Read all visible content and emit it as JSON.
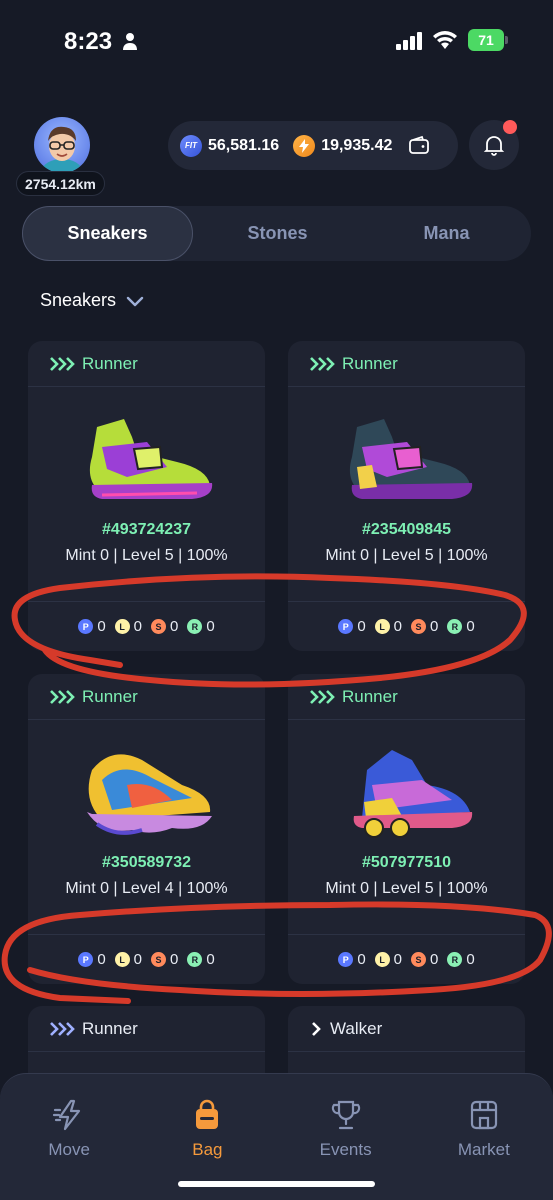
{
  "status_bar": {
    "time": "8:23",
    "battery": "71"
  },
  "header": {
    "distance": "2754.12km",
    "fit_balance": "56,581.16",
    "energy_balance": "19,935.42",
    "fit_coin_label": "FIT"
  },
  "tabs": [
    {
      "label": "Sneakers",
      "active": true
    },
    {
      "label": "Stones",
      "active": false
    },
    {
      "label": "Mana",
      "active": false
    }
  ],
  "filter": {
    "label": "Sneakers"
  },
  "cards": [
    {
      "type": "Runner",
      "id": "#493724237",
      "stats": "Mint 0 | Level 5 | 100%",
      "attrs": {
        "P": "0",
        "L": "0",
        "S": "0",
        "R": "0"
      }
    },
    {
      "type": "Runner",
      "id": "#235409845",
      "stats": "Mint 0 | Level 5 | 100%",
      "attrs": {
        "P": "0",
        "L": "0",
        "S": "0",
        "R": "0"
      }
    },
    {
      "type": "Runner",
      "id": "#350589732",
      "stats": "Mint 0 | Level 4 | 100%",
      "attrs": {
        "P": "0",
        "L": "0",
        "S": "0",
        "R": "0"
      }
    },
    {
      "type": "Runner",
      "id": "#507977510",
      "stats": "Mint 0 | Level 5 | 100%",
      "attrs": {
        "P": "0",
        "L": "0",
        "S": "0",
        "R": "0"
      }
    },
    {
      "type": "Runner"
    },
    {
      "type": "Walker"
    }
  ],
  "attr_letters": {
    "p": "P",
    "l": "L",
    "s": "S",
    "r": "R"
  },
  "nav": [
    {
      "label": "Move",
      "icon": "lightning-icon"
    },
    {
      "label": "Bag",
      "icon": "bag-icon",
      "active": true
    },
    {
      "label": "Events",
      "icon": "trophy-icon"
    },
    {
      "label": "Market",
      "icon": "store-icon"
    }
  ],
  "colors": {
    "accent_green": "#7ef0b4",
    "nav_active": "#f59a3c",
    "annotation_red": "#d63a2a"
  }
}
